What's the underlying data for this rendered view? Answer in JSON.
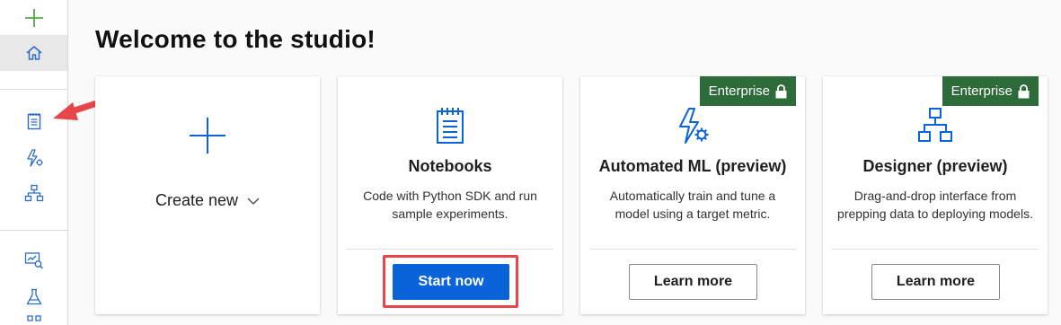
{
  "page": {
    "title": "Welcome to the studio!"
  },
  "sidebar": {
    "items": [
      {
        "icon": "plus-icon"
      },
      {
        "icon": "home-icon"
      },
      {
        "icon": "notebook-icon"
      },
      {
        "icon": "automated-ml-icon"
      },
      {
        "icon": "designer-icon"
      },
      {
        "icon": "datasets-icon"
      },
      {
        "icon": "experiments-icon"
      }
    ]
  },
  "cards": {
    "create": {
      "label": "Create new"
    },
    "notebooks": {
      "heading": "Notebooks",
      "description": "Code with Python SDK and run sample experiments.",
      "button": "Start now"
    },
    "automl": {
      "badge": "Enterprise",
      "heading": "Automated ML (preview)",
      "description": "Automatically train and tune a model using a target metric.",
      "button": "Learn more"
    },
    "designer": {
      "badge": "Enterprise",
      "heading": "Designer (preview)",
      "description": "Drag-and-drop interface from prepping data to deploying models.",
      "button": "Learn more"
    }
  },
  "colors": {
    "accent": "#0a63d8",
    "enterprise_badge": "#2e6b3a",
    "annotation": "#e8474a"
  }
}
